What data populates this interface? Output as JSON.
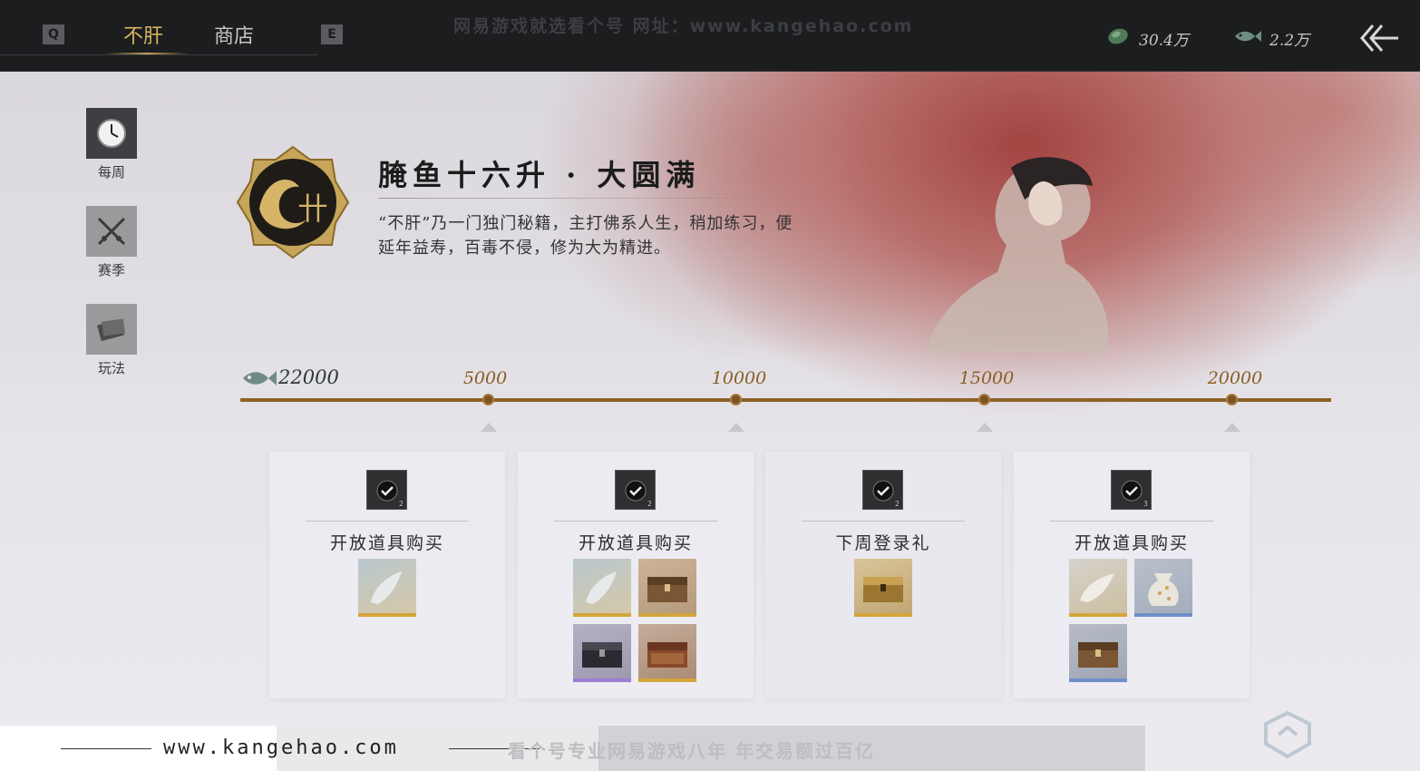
{
  "topbar": {
    "key_left": "Q",
    "key_right": "E",
    "tabs": [
      {
        "label": "不肝",
        "active": true
      },
      {
        "label": "商店",
        "active": false
      }
    ],
    "watermark": "网易游戏就选看个号   网址：www.kangehao.com",
    "currencies": [
      {
        "icon": "jade-coin-icon",
        "value": "30.4万"
      },
      {
        "icon": "salted-fish-icon",
        "value": "2.2万"
      }
    ],
    "back_icon": "back-arrow-icon"
  },
  "sidebar": {
    "items": [
      {
        "label": "每周",
        "icon": "clock-icon",
        "active": true
      },
      {
        "label": "赛季",
        "icon": "crossed-swords-icon",
        "active": false
      },
      {
        "label": "玩法",
        "icon": "scroll-book-icon",
        "active": false
      }
    ]
  },
  "header": {
    "title": "腌鱼十六升 · 大圆满",
    "description": "“不肝”乃一门独门秘籍，主打佛系人生，稍加练习，便延年益寿，百毒不侵，修为大为精进。",
    "emblem": "fish-badge-icon"
  },
  "progress": {
    "current": 22000,
    "current_label": "22000",
    "milestones": [
      {
        "label": "5000",
        "value": 5000
      },
      {
        "label": "10000",
        "value": 10000
      },
      {
        "label": "15000",
        "value": 15000
      },
      {
        "label": "20000",
        "value": 20000
      }
    ]
  },
  "rewards": [
    {
      "name": "开放道具购买",
      "claim_count": "2",
      "claimed": true,
      "items": [
        "crystal-fish-item"
      ]
    },
    {
      "name": "开放道具购买",
      "claim_count": "2",
      "claimed": true,
      "items": [
        "crystal-fish-item",
        "wooden-chest-item",
        "dark-chest-item",
        "ornate-chest-item"
      ]
    },
    {
      "name": "下周登录礼",
      "claim_count": "2",
      "claimed": true,
      "items": [
        "golden-chest-item"
      ]
    },
    {
      "name": "开放道具购买",
      "claim_count": "3",
      "claimed": true,
      "items": [
        "crystal-fish-item",
        "pouch-bag-item",
        "wooden-chest-item"
      ]
    }
  ],
  "footer": {
    "url": "www.kangehao.com",
    "slogan": "看个号专业网易游戏八年   年交易额过百亿"
  },
  "colors": {
    "accent_gold": "#d9b35f",
    "track_brown": "#8c6228",
    "milestone_text": "#8a5f24",
    "topbar_bg": "#1b1d1f"
  }
}
